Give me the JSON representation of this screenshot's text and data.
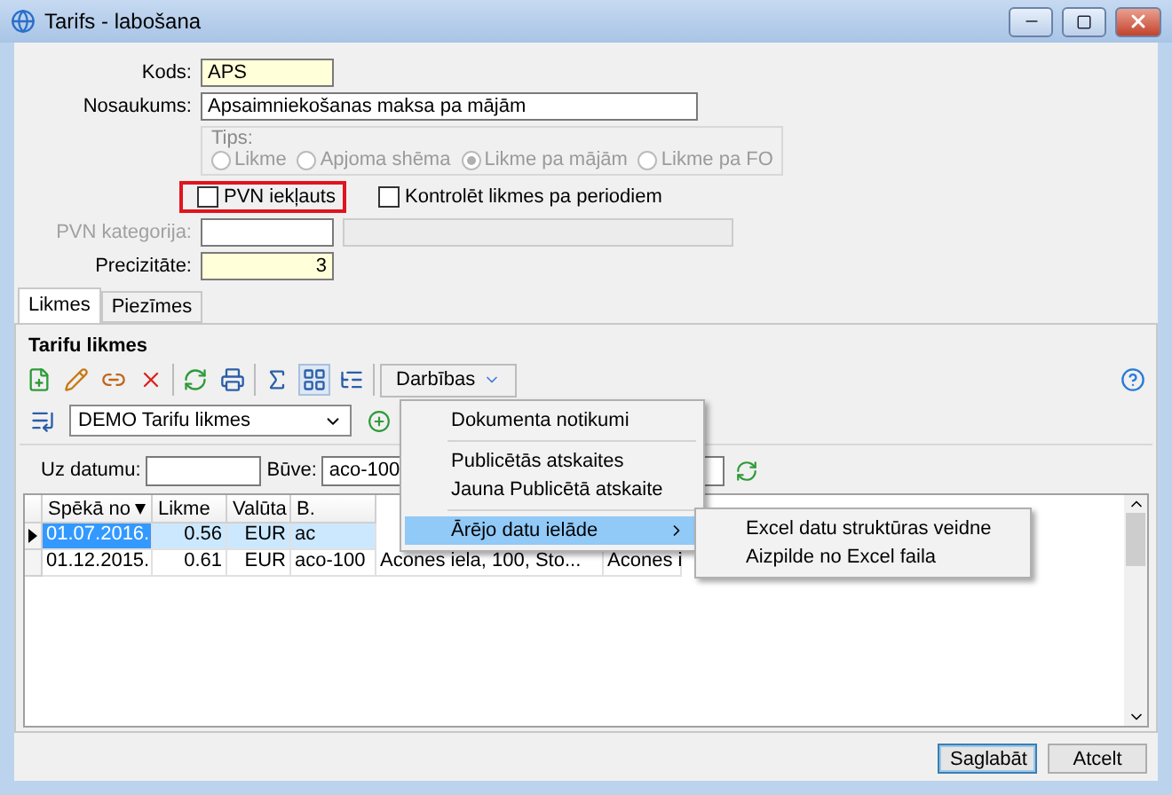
{
  "window": {
    "title": "Tarifs - labošana"
  },
  "form": {
    "code": {
      "label": "Kods:",
      "value": "APS"
    },
    "name": {
      "label": "Nosaukums:",
      "value": "Apsaimniekošanas maksa pa mājām"
    },
    "tips": {
      "label": "Tips:",
      "disabled": true,
      "options": [
        {
          "label": "Likme",
          "selected": false
        },
        {
          "label": "Apjoma shēma",
          "selected": false
        },
        {
          "label": "Likme pa mājām",
          "selected": true
        },
        {
          "label": "Likme pa FO",
          "selected": false
        }
      ]
    },
    "checkboxes": [
      {
        "label": "PVN iekļauts",
        "checked": false,
        "highlighted": true
      },
      {
        "label": "Kontrolēt likmes pa periodiem",
        "checked": false,
        "highlighted": false
      }
    ],
    "vat_category": {
      "label": "PVN kategorija:",
      "disabled": true
    },
    "precision": {
      "label": "Precizitāte:",
      "value": "3"
    }
  },
  "tabs": [
    {
      "label": "Likmes",
      "selected": true
    },
    {
      "label": "Piezīmes",
      "selected": false
    }
  ],
  "panel": {
    "title": "Tarifu likmes",
    "actions_button": "Darbības",
    "selector": "DEMO Tarifu likmes",
    "date_filter": {
      "label": "Uz datumu:"
    },
    "building_filter": {
      "label": "Būve:",
      "value": "aco-100"
    }
  },
  "grid": {
    "columns": [
      "Spēkā no",
      "Likme",
      "Valūta",
      "B."
    ],
    "rows": [
      {
        "selected": true,
        "cells": [
          "01.07.2016.",
          "0.56",
          "EUR",
          "ac"
        ]
      },
      {
        "selected": false,
        "cells": [
          "01.12.2015.",
          "0.61",
          "EUR",
          "aco-100",
          "Acones iela, 100, Sto...",
          "Acones i"
        ]
      }
    ]
  },
  "menu": {
    "items": [
      {
        "kind": "item",
        "label": "Dokumenta notikumi",
        "selected": false
      },
      {
        "kind": "separator"
      },
      {
        "kind": "item",
        "label": "Publicētās atskaites",
        "selected": false
      },
      {
        "kind": "item",
        "label": "Jauna Publicētā atskaite",
        "selected": false
      },
      {
        "kind": "separator"
      },
      {
        "kind": "submenu",
        "label": "Ārējo datu ielāde",
        "selected": true
      }
    ],
    "submenu": [
      "Excel datu struktūras veidne",
      "Aizpilde no Excel faila"
    ]
  },
  "buttons": [
    {
      "label": "Saglabāt",
      "default": true
    },
    {
      "label": "Atcelt",
      "default": false
    }
  ]
}
